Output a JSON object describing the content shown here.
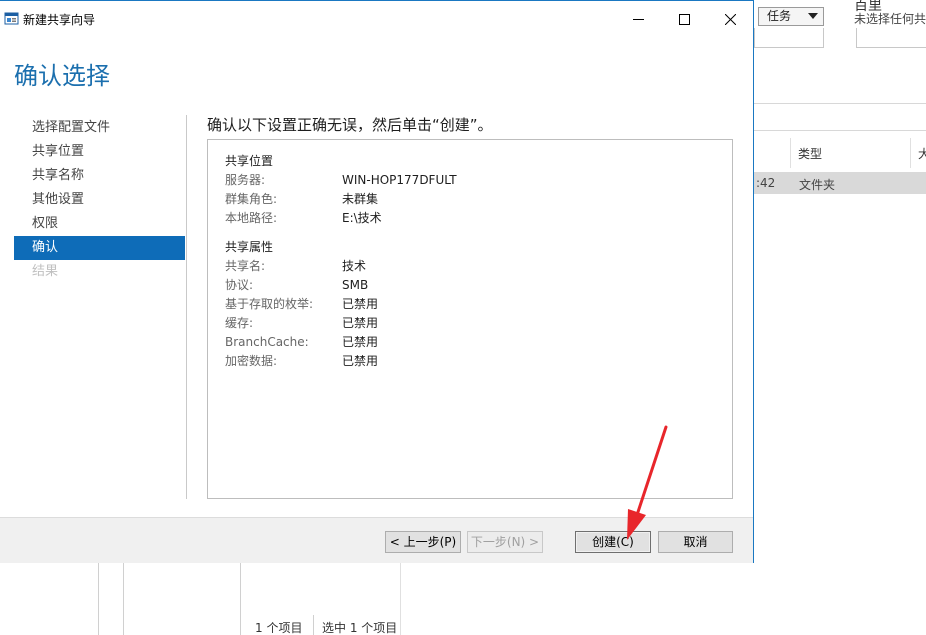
{
  "background": {
    "tasks_label": "任务",
    "properties_title": "百里",
    "properties_subtitle": "未选择任何共",
    "column_type": "类型",
    "column_size": "大",
    "row_time": ":42",
    "row_type": "文件夹",
    "status_count": "1 个项目",
    "status_selected": "选中 1 个项目"
  },
  "wizard": {
    "window_title": "新建共享向导",
    "page_title": "确认选择",
    "instruction": "确认以下设置正确无误，然后单击“创建”。",
    "steps": [
      {
        "label": "选择配置文件",
        "state": "normal"
      },
      {
        "label": "共享位置",
        "state": "normal"
      },
      {
        "label": "共享名称",
        "state": "normal"
      },
      {
        "label": "其他设置",
        "state": "normal"
      },
      {
        "label": "权限",
        "state": "normal"
      },
      {
        "label": "确认",
        "state": "active"
      },
      {
        "label": "结果",
        "state": "disabled"
      }
    ],
    "summary": {
      "location": {
        "header": "共享位置",
        "rows": [
          {
            "key": "服务器:",
            "value": "WIN-HOP177DFULT"
          },
          {
            "key": "群集角色:",
            "value": "未群集"
          },
          {
            "key": "本地路径:",
            "value": "E:\\技术"
          }
        ]
      },
      "properties": {
        "header": "共享属性",
        "rows": [
          {
            "key": "共享名:",
            "value": "技术"
          },
          {
            "key": "协议:",
            "value": "SMB"
          },
          {
            "key": "基于存取的枚举:",
            "value": "已禁用"
          },
          {
            "key": "缓存:",
            "value": "已禁用"
          },
          {
            "key": "BranchCache:",
            "value": "已禁用"
          },
          {
            "key": "加密数据:",
            "value": "已禁用"
          }
        ]
      }
    },
    "buttons": {
      "previous": "< 上一步(P)",
      "next": "下一步(N) >",
      "create": "创建(C)",
      "cancel": "取消"
    },
    "colors": {
      "accent": "#0e6cb8",
      "title": "#1b6fae",
      "annotation_arrow": "#e8262b"
    }
  }
}
